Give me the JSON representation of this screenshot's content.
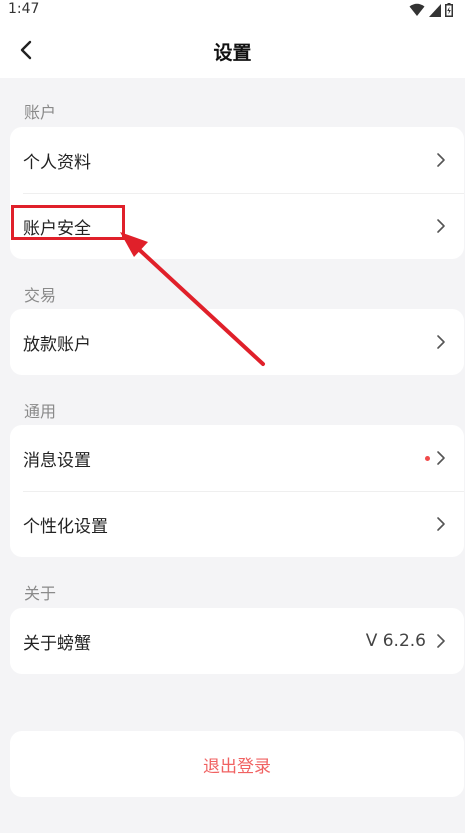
{
  "status_bar": {
    "time": "1:47"
  },
  "nav": {
    "title": "设置"
  },
  "sections": {
    "account": {
      "header": "账户",
      "items": [
        {
          "label": "个人资料"
        },
        {
          "label": "账户安全"
        }
      ]
    },
    "trade": {
      "header": "交易",
      "items": [
        {
          "label": "放款账户"
        }
      ]
    },
    "general": {
      "header": "通用",
      "items": [
        {
          "label": "消息设置"
        },
        {
          "label": "个性化设置"
        }
      ]
    },
    "about": {
      "header": "关于",
      "items": [
        {
          "label": "关于螃蟹",
          "value": "V 6.2.6"
        }
      ]
    }
  },
  "logout": {
    "label": "退出登录"
  },
  "colors": {
    "background": "#f4f4f6",
    "accent_red": "#f06262",
    "annotation_red": "#e0202a",
    "badge_dot": "#f04a4a"
  },
  "icons": [
    "back-arrow-icon",
    "wifi-icon",
    "signal-icon",
    "battery-icon",
    "chevron-right-icon"
  ]
}
